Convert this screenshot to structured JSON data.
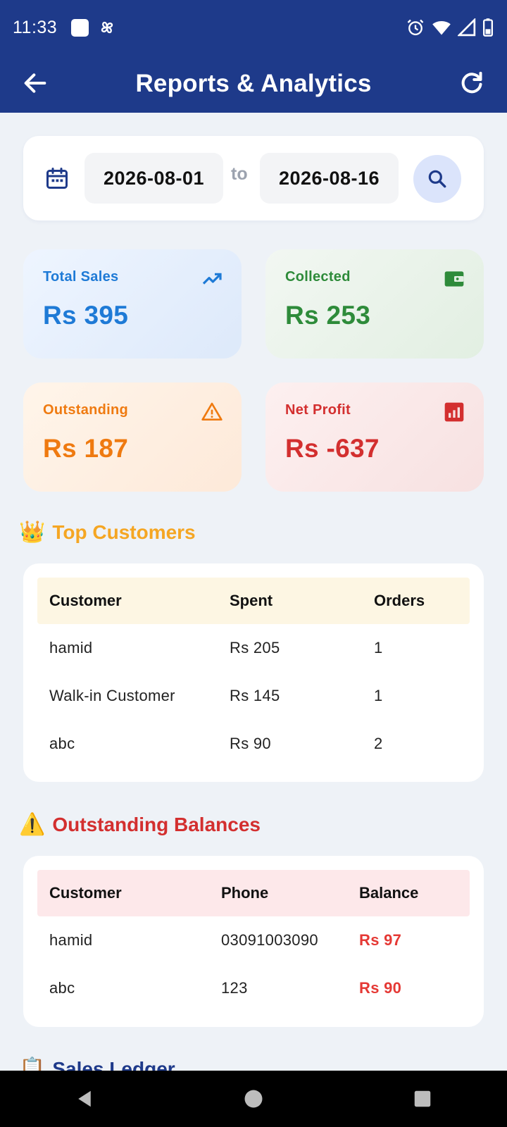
{
  "status_bar": {
    "time": "11:33"
  },
  "app_bar": {
    "title": "Reports & Analytics"
  },
  "date_range": {
    "from": "2026-08-01",
    "separator": "to",
    "to": "2026-08-16"
  },
  "stats": {
    "total_sales": {
      "label": "Total Sales",
      "value": "Rs 395",
      "color": "#1e7ad6"
    },
    "collected": {
      "label": "Collected",
      "value": "Rs 253",
      "color": "#2e8b3a"
    },
    "outstanding": {
      "label": "Outstanding",
      "value": "Rs 187",
      "color": "#ef7a10"
    },
    "net_profit": {
      "label": "Net Profit",
      "value": "Rs -637",
      "color": "#d32f2f"
    }
  },
  "top_customers": {
    "title": "Top Customers",
    "emoji": "👑",
    "headers": [
      "Customer",
      "Spent",
      "Orders"
    ],
    "rows": [
      [
        "hamid",
        "Rs 205",
        "1"
      ],
      [
        "Walk-in Customer",
        "Rs 145",
        "1"
      ],
      [
        "abc",
        "Rs 90",
        "2"
      ]
    ]
  },
  "outstanding_balances": {
    "title": "Outstanding Balances",
    "emoji": "⚠️",
    "headers": [
      "Customer",
      "Phone",
      "Balance"
    ],
    "rows": [
      [
        "hamid",
        "03091003090",
        "Rs 97"
      ],
      [
        "abc",
        "123",
        "Rs 90"
      ]
    ]
  },
  "sales_ledger": {
    "title": "Sales Ledger",
    "emoji": "📋"
  },
  "colors": {
    "primary": "#1e3a8a",
    "background": "#eef2f7"
  }
}
